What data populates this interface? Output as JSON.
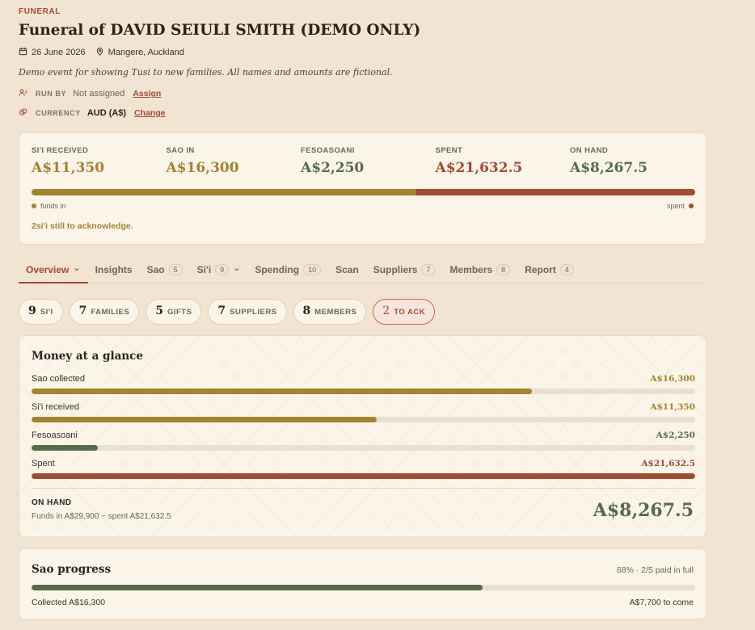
{
  "header": {
    "eyebrow": "FUNERAL",
    "title": "Funeral of DAVID SEIULI SMITH (DEMO ONLY)",
    "date": "26 June 2026",
    "location": "Mangere, Auckland",
    "description": "Demo event for showing Tusi to new families. All names and amounts are fictional.",
    "run_by": {
      "label": "RUN BY",
      "value": "Not assigned",
      "action": "Assign"
    },
    "currency": {
      "label": "CURRENCY",
      "value": "AUD (A$)",
      "action": "Change"
    }
  },
  "summary": {
    "stats": [
      {
        "label": "SI'I RECEIVED",
        "value": "A$11,350",
        "color": "#a5832e"
      },
      {
        "label": "SAO IN",
        "value": "A$16,300",
        "color": "#a5832e"
      },
      {
        "label": "FESOASOANI",
        "value": "A$2,250",
        "color": "#566b4a"
      },
      {
        "label": "SPENT",
        "value": "A$21,632.5",
        "color": "#a24b31"
      },
      {
        "label": "ON HAND",
        "value": "A$8,267.5",
        "color": "#566b4a"
      }
    ],
    "funds_in_fraction": 0.58,
    "legend_left": "funds in",
    "legend_right": "spent",
    "ack_note": "2si'i still to acknowledge."
  },
  "tabs": [
    {
      "label": "Overview",
      "count": "",
      "chevron": true,
      "active": true
    },
    {
      "label": "Insights",
      "count": ""
    },
    {
      "label": "Sao",
      "count": "5"
    },
    {
      "label": "Si'i",
      "count": "9",
      "chevron": true
    },
    {
      "label": "Spending",
      "count": "10"
    },
    {
      "label": "Scan",
      "count": ""
    },
    {
      "label": "Suppliers",
      "count": "7"
    },
    {
      "label": "Members",
      "count": "8"
    },
    {
      "label": "Report",
      "count": "4"
    }
  ],
  "chips": [
    {
      "n": "9",
      "label": "SI'I"
    },
    {
      "n": "7",
      "label": "FAMILIES"
    },
    {
      "n": "5",
      "label": "GIFTS"
    },
    {
      "n": "7",
      "label": "SUPPLIERS"
    },
    {
      "n": "8",
      "label": "MEMBERS"
    },
    {
      "n": "2",
      "label": "TO ACK",
      "alert": true
    }
  ],
  "glance": {
    "title": "Money at a glance",
    "rows": [
      {
        "label": "Sao collected",
        "amount": "A$16,300",
        "fraction": 0.754,
        "color": "#a5832e"
      },
      {
        "label": "Si'i received",
        "amount": "A$11,350",
        "fraction": 0.52,
        "color": "#a5832e"
      },
      {
        "label": "Fesoasoani",
        "amount": "A$2,250",
        "fraction": 0.1,
        "color": "#566b4a"
      },
      {
        "label": "Spent",
        "amount": "A$21,632.5",
        "fraction": 1.0,
        "color": "#a24b31"
      }
    ],
    "on_hand_label": "ON HAND",
    "on_hand_sub": "Funds in A$29,900 − spent A$21,632.5",
    "on_hand_value": "A$8,267.5"
  },
  "sao_progress": {
    "title": "Sao progress",
    "meta": "68% · 2/5 paid in full",
    "fraction": 0.68,
    "collected": "Collected A$16,300",
    "to_come": "A$7,700 to come"
  }
}
